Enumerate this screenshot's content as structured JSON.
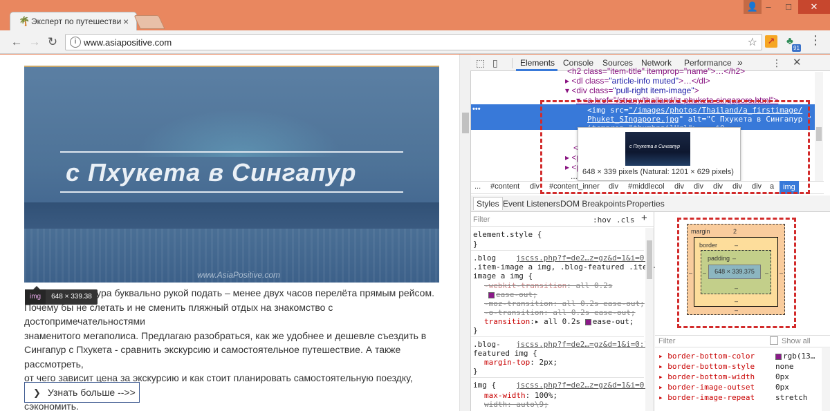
{
  "browser": {
    "tab_title": "Эксперт по путешестви",
    "url": "www.asiapositive.com",
    "extension_badge": "91"
  },
  "page": {
    "hero_title": "с Пхукета в Сингапур",
    "hero_watermark": "www.AsiaPositive.com",
    "img_tooltip_tag": "img",
    "img_tooltip_size": "648 × 339.38",
    "article_line1": "гапура буквально рукой подать – менее двух часов перелёта прямым рейсом.",
    "article_line2": "Почему бы не слетать и не сменить пляжный отдых на знакомство с достопримечательностями",
    "article_line3": "знаменитого мегаполиса. Предлагаю разобраться, как же удобнее и дешевле съездить в",
    "article_line4": "Сингапур с Пхукета - сравнить экскурсию и самостоятельное путешествие. А также рассмотреть,",
    "article_line5": "от чего зависит цена за экскурсию и как стоит планировать самостоятельную поездку, чтобы",
    "article_line6": "сэкономить.",
    "more_button": "Узнать больше -->>"
  },
  "devtools": {
    "tabs": [
      "Elements",
      "Console",
      "Sources",
      "Network",
      "Performance"
    ],
    "more_tabs": "»",
    "elements": {
      "line1": "<h2 class=\"item-title\" itemprop=\"name\">…</h2>",
      "line2_tag": "<dl class=",
      "line2_val": "\"article-info muted\"",
      "line2_end": ">…</dl>",
      "line3_tag": "<div class=",
      "line3_val": "\"pull-right item-image\"",
      "line3_end": ">",
      "line4": "<a href=\"/strany/thailand/iz-phuketa-singapore.html\">",
      "sel_tag": "<img src=",
      "sel_src1": "\"/images/photos/Thailand/a_firstimage/",
      "sel_src2": "Phuket_SIngapore.jpg",
      "sel_alt": "\" alt=\"С Пхукета в Сингапур \"",
      "sel_line3": "itemprop=\"thumbnailUrl\"> == $0",
      "line_close_a": "</a>",
      "line_p1": "<p",
      "line_p2": "<p",
      "line_dots": "..."
    },
    "preview": {
      "thumb_text": "с Пхукета в Сингапур",
      "caption": "648 × 339 pixels (Natural: 1201 × 629 pixels)"
    },
    "breadcrumbs": [
      "...",
      "#content",
      "div",
      "#content_inner",
      "div",
      "#middlecol",
      "div",
      "div",
      "div",
      "div",
      "div",
      "a",
      "img"
    ],
    "subtabs": [
      "Styles",
      "Event Listeners",
      "DOM Breakpoints",
      "Properties"
    ],
    "styles": {
      "filter_placeholder": "Filter",
      "hov": ":hov",
      "cls": ".cls",
      "plus": "+",
      "element_style": "element.style {",
      "close_brace": "}",
      "rule1_selector1": ".blog",
      "rule1_link": "jscss.php?f=de2…z=gz&d=1&i=0:5",
      "rule1_selector2": ".item-image a img, .blog-featured .item-",
      "rule1_selector3": "image a img {",
      "rule1_p1_name": "-webkit-transition",
      "rule1_p1_val": ": all 0.2s",
      "rule1_p1_cont": "ease-out;",
      "rule1_p2": "-moz-transition: all 0.2s ease-out;",
      "rule1_p3": "-o-transition: all 0.2s ease-out;",
      "rule1_p4_name": "transition",
      "rule1_p4_val": ":▸ all 0.2s ",
      "rule1_p4_end": "ease-out;",
      "rule2_selector1": ".blog-",
      "rule2_link": "jscss.php?f=de2…=gz&d=1&i=0:11",
      "rule2_selector2": "featured img {",
      "rule2_p1_name": "margin-top",
      "rule2_p1_val": ": 2px;",
      "rule3_selector": "img {",
      "rule3_link": "jscss.php?f=de2…z=gz&d=1&i=0:5",
      "rule3_p1_name": "max-width",
      "rule3_p1_val": ": 100%;",
      "rule3_p2": "width: auto\\9;"
    },
    "box_model": {
      "margin_label": "margin",
      "margin_top": "2",
      "border_label": "border",
      "padding_label": "padding",
      "dash": "–",
      "content": "648 × 339.375"
    },
    "computed": {
      "filter_placeholder": "Filter",
      "show_all": "Show all",
      "props": [
        {
          "name": "border-bottom-color",
          "value": "rgb(13…"
        },
        {
          "name": "border-bottom-style",
          "value": "none"
        },
        {
          "name": "border-bottom-width",
          "value": "0px"
        },
        {
          "name": "border-image-outset",
          "value": "0px"
        },
        {
          "name": "border-image-repeat",
          "value": "stretch"
        }
      ]
    }
  },
  "colors": {
    "window_frame": "#E9875F",
    "selection_blue": "#3879D9",
    "annotation_red": "#D22B2B",
    "link_border": "#3E5A90"
  }
}
